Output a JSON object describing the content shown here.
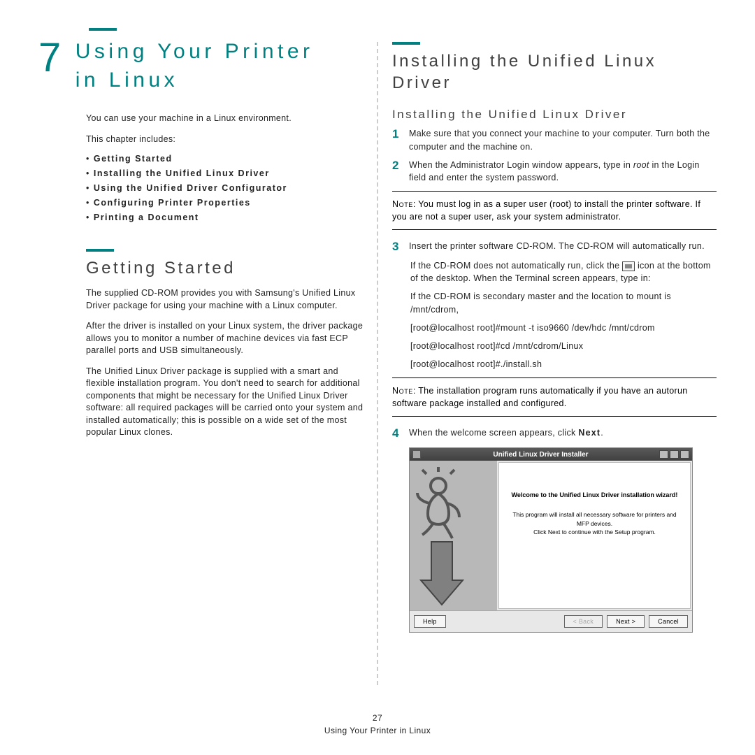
{
  "chapter": {
    "number": "7",
    "title": "Using Your Printer in Linux",
    "intro": "You can use your machine in a Linux environment.",
    "includes_label": "This chapter includes:",
    "toc": [
      "Getting Started",
      "Installing the Unified Linux Driver",
      "Using the Unified Driver Configurator",
      "Configuring Printer Properties",
      "Printing a Document"
    ]
  },
  "getting_started": {
    "heading": "Getting Started",
    "p1": "The supplied CD-ROM provides you with Samsung's Unified Linux Driver package for using your machine with a Linux computer.",
    "p2": "After the driver is installed on your Linux system, the driver package allows you to monitor a number of machine devices via fast ECP parallel ports and USB simultaneously.",
    "p3": "The Unified Linux Driver package is supplied with a smart and flexible installation program. You don't need to search for additional components that might be necessary for the Unified Linux Driver software: all required packages will be carried onto your system and installed automatically; this is possible on a wide set of the most popular Linux clones."
  },
  "installing": {
    "heading": "Installing the Unified Linux Driver",
    "subheading": "Installing the Unified Linux Driver",
    "steps": {
      "s1": "Make sure that you connect your machine to your computer. Turn both the computer and the machine on.",
      "s2_a": "When the Administrator Login window appears, type in ",
      "s2_root": "root",
      "s2_b": " in the Login field and enter the system password.",
      "s3": "Insert the printer software CD-ROM. The CD-ROM will automatically run.",
      "s3_sub1_a": "If the CD-ROM does not automatically run, click the ",
      "s3_sub1_b": " icon at the bottom of the desktop. When the Terminal screen appears, type in:",
      "s3_sub2": "If the CD-ROM is secondary master and the location to mount is /mnt/cdrom,",
      "s3_cmd1": "[root@localhost root]#mount -t iso9660 /dev/hdc /mnt/cdrom",
      "s3_cmd2": "[root@localhost root]#cd /mnt/cdrom/Linux",
      "s3_cmd3": "[root@localhost root]#./install.sh",
      "s4_a": "When the welcome screen appears, click ",
      "s4_b": "Next",
      "s4_c": "."
    },
    "note1_label": "Note",
    "note1": ": You must log in as a super user (root) to install the printer software. If you are not a super user, ask your system administrator.",
    "note2_label": "Note",
    "note2": ": The installation program runs automatically if you have an autorun software package installed and configured."
  },
  "installer": {
    "title": "Unified Linux Driver Installer",
    "welcome": "Welcome to the Unified Linux Driver installation wizard!",
    "desc1": "This program will install all necessary software for printers and MFP devices.",
    "desc2": "Click Next to continue with the Setup program.",
    "help": "Help",
    "back": "< Back",
    "next": "Next >",
    "cancel": "Cancel"
  },
  "footer": {
    "page": "27",
    "label": "Using Your Printer in Linux"
  }
}
